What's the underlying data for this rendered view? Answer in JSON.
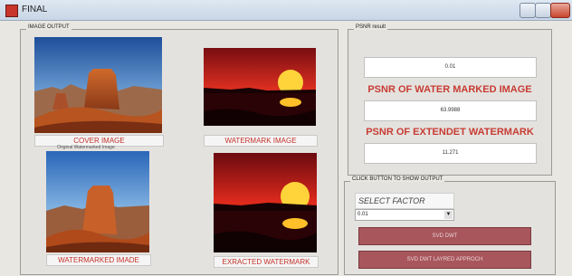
{
  "window": {
    "title": "FINAL"
  },
  "image_output": {
    "legend": "IMAGE OUTPUT",
    "cover_label": "COVER IMAGE",
    "watermark_label": "WATERMARK IMAGE",
    "watermarked_label": "WATERMARKED IMADE",
    "extracted_label": "EXRACTED WATERMARK",
    "ghost_text": "Original Watermarked Image"
  },
  "psnr": {
    "legend": "PSNR result",
    "factor_value": "0.01",
    "heading_watermarked": "PSNR OF WATER MARKED IMAGE",
    "watermarked_value": "63.9988",
    "heading_extracted": "PSNR OF EXTENDET WATERMARK",
    "extracted_value": "11.271"
  },
  "controls": {
    "legend": "CLICK  BUTTON TO SHOW OUTPUT",
    "select_factor_label": "SELECT FACTOR",
    "factor_selected": "0.01",
    "svd_dwt_label": "SVD DWT",
    "svd_dwt_layered_label": "SVD DWT LAYRED APPROCH"
  },
  "colors": {
    "accent_red": "#c73c34",
    "button": "#a8565c"
  }
}
